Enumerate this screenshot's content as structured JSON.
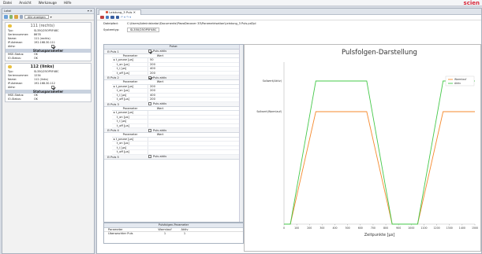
{
  "menu": [
    "Datei",
    "Ansicht",
    "Werkzeuge",
    "Hilfe"
  ],
  "brand": "scien",
  "left": {
    "title": "Lokal",
    "filter": "Alle anzeigen",
    "devices": [
      {
        "name": "111 (rechts)",
        "props": [
          [
            "Typ:",
            "SL350/25OP5F48C"
          ],
          [
            "Seriennummer:",
            "8678"
          ],
          [
            "Name:",
            "111 (rechts)"
          ],
          [
            "IP-Adresse:",
            "192.168.30.111"
          ],
          [
            "Aktiv:",
            ""
          ]
        ],
        "status": "Statusparameter",
        "stat": [
          [
            "MSE-Status:",
            "OK"
          ],
          [
            "IO-Status:",
            "OK"
          ]
        ]
      },
      {
        "name": "112 (links)",
        "props": [
          [
            "Typ:",
            "SL350/25OP5F48C"
          ],
          [
            "Seriennummer:",
            "1234"
          ],
          [
            "Name:",
            "112 (links)"
          ],
          [
            "IP-Adresse:",
            "192.168.30.112"
          ],
          [
            "Aktiv:",
            ""
          ]
        ],
        "status": "Statusparameter",
        "stat": [
          [
            "MSE-Status:",
            "OK"
          ],
          [
            "IO-Status:",
            "OK"
          ]
        ]
      }
    ]
  },
  "doc": {
    "tab": "Leistung_3 Puls",
    "datei_label": "Dateipfad:",
    "datei_value": "C:\\Users\\Administrator\\Documents\\PiezoDecover 33\\Parametrisation\\Leistung_3 Puls.pd2pl",
    "typ_label": "Systemtyp:",
    "typ_value": "SL350/25OP5F48C",
    "grid_header": "Pulse:",
    "pulses": [
      {
        "label": "Puls 1",
        "active": "Puls aktiv",
        "checked": true,
        "col1": "Parameter",
        "col2": "Wert",
        "rows": [
          [
            "t_pause [µs]",
            "50"
          ],
          [
            "t_on [µs]",
            "200"
          ],
          [
            "t_i [µs]",
            "400"
          ],
          [
            "t_off [µs]",
            "200"
          ]
        ]
      },
      {
        "label": "Puls 2",
        "active": "Puls aktiv",
        "checked": true,
        "col1": "Parameter",
        "col2": "Wert",
        "rows": [
          [
            "t_pause [µs]",
            "200"
          ],
          [
            "t_on [µs]",
            "200"
          ],
          [
            "t_i [µs]",
            "400"
          ],
          [
            "t_off [µs]",
            "200"
          ]
        ]
      },
      {
        "label": "Puls 3",
        "active": "Puls aktiv",
        "checked": false,
        "col1": "Parameter",
        "col2": "Wert",
        "rows": [
          [
            "t_pause [µs]",
            ""
          ],
          [
            "t_on [µs]",
            ""
          ],
          [
            "t_i [µs]",
            ""
          ],
          [
            "t_off [µs]",
            ""
          ]
        ]
      },
      {
        "label": "Puls 4",
        "active": "Puls aktiv",
        "checked": false,
        "col1": "Parameter",
        "col2": "Wert",
        "rows": [
          [
            "t_pause [µs]",
            ""
          ],
          [
            "t_on [µs]",
            ""
          ],
          [
            "t_i [µs]",
            ""
          ],
          [
            "t_off [µs]",
            ""
          ]
        ]
      },
      {
        "label": "Puls 5",
        "active": "Puls aktiv",
        "checked": false,
        "col1": "Parameter",
        "col2": "Wert",
        "rows": []
      }
    ],
    "pp": {
      "title": "Pulsfolgen-Parameter",
      "h1": "Parameter",
      "h2": "Warmlauf",
      "h3": "Aktiv",
      "r1": "Überwachter Puls",
      "r2": "1",
      "r3": "1"
    }
  },
  "colors": {
    "warmlauf": "#f58a2e",
    "aktiv": "#45c84a"
  },
  "chart_data": {
    "type": "line",
    "title": "Pulsfolgen-Darstellung",
    "xlabel": "Zeitpunkte [µs]",
    "ylabel": "",
    "xlim": [
      0,
      1500
    ],
    "xticks": [
      0,
      100,
      200,
      300,
      400,
      500,
      600,
      700,
      800,
      900,
      1000,
      1100,
      1200,
      1300,
      1400,
      1500
    ],
    "y_levels": [
      "Sollwert(Aktiv)",
      "Sollwert(Warmlauf)"
    ],
    "legend": "top-right",
    "series": [
      {
        "name": "Warmlauf",
        "color": "#f58a2e",
        "x": [
          0,
          50,
          250,
          650,
          850,
          1050,
          1250,
          1650
        ],
        "y": [
          0,
          0,
          "Sollwert(Warmlauf)",
          "Sollwert(Warmlauf)",
          0,
          0,
          "Sollwert(Warmlauf)",
          "Sollwert(Warmlauf)"
        ]
      },
      {
        "name": "Aktiv",
        "color": "#45c84a",
        "x": [
          0,
          50,
          250,
          650,
          850,
          1050,
          1250,
          1650
        ],
        "y": [
          0,
          0,
          "Sollwert(Aktiv)",
          "Sollwert(Aktiv)",
          0,
          0,
          "Sollwert(Aktiv)",
          "Sollwert(Aktiv)"
        ]
      }
    ]
  }
}
